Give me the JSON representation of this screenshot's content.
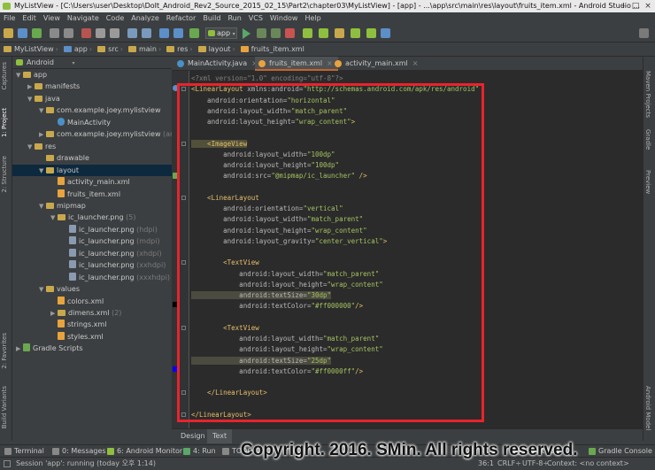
{
  "window": {
    "title": "MyListView - [C:\\Users\\user\\Desktop\\DoIt_Android_Rev2_Source_2015_02_15\\Part2\\chapter03\\MyListView] - [app] - ...\\app\\src\\main\\res\\layout\\fruits_item.xml - Android Studio ..."
  },
  "menu": [
    "File",
    "Edit",
    "View",
    "Navigate",
    "Code",
    "Analyze",
    "Refactor",
    "Build",
    "Run",
    "VCS",
    "Window",
    "Help"
  ],
  "toolbar": {
    "run_config": "app"
  },
  "breadcrumbs": [
    "MyListView",
    "app",
    "src",
    "main",
    "res",
    "layout",
    "fruits_item.xml"
  ],
  "left_strip": {
    "captures": "Captures",
    "project": "1: Project",
    "structure": "2: Structure",
    "favorites": "2: Favorites",
    "build_variants": "Build Variants"
  },
  "right_strip": {
    "maven": "Maven Projects",
    "gradle": "Gradle",
    "preview": "Preview",
    "android_model": "Android Model"
  },
  "project_panel": {
    "view_mode": "Android",
    "tree": [
      {
        "label": "app",
        "depth": 0,
        "arrow": "▼",
        "icon": "folder"
      },
      {
        "label": "manifests",
        "depth": 1,
        "arrow": "▶",
        "icon": "folder"
      },
      {
        "label": "java",
        "depth": 1,
        "arrow": "▼",
        "icon": "folder"
      },
      {
        "label": "com.example.joey.mylistview",
        "depth": 2,
        "arrow": "▼",
        "icon": "folder"
      },
      {
        "label": "MainActivity",
        "depth": 3,
        "arrow": "",
        "icon": "class"
      },
      {
        "label": "com.example.joey.mylistview",
        "suffix": "(andro",
        "depth": 2,
        "arrow": "▶",
        "icon": "folder"
      },
      {
        "label": "res",
        "depth": 1,
        "arrow": "▼",
        "icon": "folder"
      },
      {
        "label": "drawable",
        "depth": 2,
        "arrow": "",
        "icon": "folder"
      },
      {
        "label": "layout",
        "depth": 2,
        "arrow": "▼",
        "icon": "folder",
        "selected": true
      },
      {
        "label": "activity_main.xml",
        "depth": 3,
        "arrow": "",
        "icon": "xml"
      },
      {
        "label": "fruits_item.xml",
        "depth": 3,
        "arrow": "",
        "icon": "xml"
      },
      {
        "label": "mipmap",
        "depth": 2,
        "arrow": "▼",
        "icon": "folder"
      },
      {
        "label": "ic_launcher.png",
        "suffix": "(5)",
        "depth": 3,
        "arrow": "▼",
        "icon": "folder"
      },
      {
        "label": "ic_launcher.png",
        "suffix": "(hdpi)",
        "depth": 4,
        "arrow": "",
        "icon": "png"
      },
      {
        "label": "ic_launcher.png",
        "suffix": "(mdpi)",
        "depth": 4,
        "arrow": "",
        "icon": "png"
      },
      {
        "label": "ic_launcher.png",
        "suffix": "(xhdpi)",
        "depth": 4,
        "arrow": "",
        "icon": "png"
      },
      {
        "label": "ic_launcher.png",
        "suffix": "(xxhdpi)",
        "depth": 4,
        "arrow": "",
        "icon": "png"
      },
      {
        "label": "ic_launcher.png",
        "suffix": "(xxxhdpi)",
        "depth": 4,
        "arrow": "",
        "icon": "png"
      },
      {
        "label": "values",
        "depth": 2,
        "arrow": "▼",
        "icon": "folder"
      },
      {
        "label": "colors.xml",
        "depth": 3,
        "arrow": "",
        "icon": "xml"
      },
      {
        "label": "dimens.xml",
        "suffix": "(2)",
        "depth": 3,
        "arrow": "▶",
        "icon": "folder"
      },
      {
        "label": "strings.xml",
        "depth": 3,
        "arrow": "",
        "icon": "xml"
      },
      {
        "label": "styles.xml",
        "depth": 3,
        "arrow": "",
        "icon": "xml"
      },
      {
        "label": "Gradle Scripts",
        "depth": 0,
        "arrow": "▶",
        "icon": "gradle"
      }
    ]
  },
  "editor_tabs": [
    {
      "label": "MainActivity.java",
      "active": false,
      "icon_color": "#4a90c8"
    },
    {
      "label": "fruits_item.xml",
      "active": true,
      "icon_color": "#e8a33d"
    },
    {
      "label": "activity_main.xml",
      "active": false,
      "icon_color": "#e8a33d"
    }
  ],
  "code_lines": [
    [
      [
        "g",
        "<?xml version=\"1.0\" encoding=\"utf-8\"?>"
      ]
    ],
    [
      [
        "t",
        "<LinearLayout "
      ],
      [
        "a",
        "xmlns:android="
      ],
      [
        "s",
        "\"http://schemas.android.com/apk/res/android\""
      ]
    ],
    [
      [
        "a",
        "    android:orientation="
      ],
      [
        "s",
        "\"horizontal\""
      ]
    ],
    [
      [
        "a",
        "    android:layout_width="
      ],
      [
        "s",
        "\"match_parent\""
      ]
    ],
    [
      [
        "a",
        "    android:layout_height="
      ],
      [
        "s",
        "\"wrap_content\""
      ],
      [
        "t",
        ">"
      ]
    ],
    [],
    [
      [
        "t",
        "    <ImageView",
        "hl"
      ]
    ],
    [
      [
        "a",
        "        android:layout_width="
      ],
      [
        "s",
        "\"100dp\""
      ]
    ],
    [
      [
        "a",
        "        android:layout_height="
      ],
      [
        "s",
        "\"100dp\""
      ]
    ],
    [
      [
        "a",
        "        android:src="
      ],
      [
        "s",
        "\"@mipmap/ic_launcher\""
      ],
      [
        "t",
        " />"
      ]
    ],
    [],
    [
      [
        "t",
        "    <LinearLayout"
      ]
    ],
    [
      [
        "a",
        "        android:orientation="
      ],
      [
        "s",
        "\"vertical\""
      ]
    ],
    [
      [
        "a",
        "        android:layout_width="
      ],
      [
        "s",
        "\"match_parent\""
      ]
    ],
    [
      [
        "a",
        "        android:layout_height="
      ],
      [
        "s",
        "\"wrap_content\""
      ]
    ],
    [
      [
        "a",
        "        android:layout_gravity="
      ],
      [
        "s",
        "\"center_vertical\""
      ],
      [
        "t",
        ">"
      ]
    ],
    [],
    [
      [
        "t",
        "        <TextView"
      ]
    ],
    [
      [
        "a",
        "            android:layout_width="
      ],
      [
        "s",
        "\"match_parent\""
      ]
    ],
    [
      [
        "a",
        "            android:layout_height="
      ],
      [
        "s",
        "\"wrap_content\""
      ]
    ],
    [
      [
        "a",
        "            android:textSize=",
        "attrhl"
      ],
      [
        "s",
        "\"30dp\"",
        "attrhl"
      ]
    ],
    [
      [
        "a",
        "            android:textColor="
      ],
      [
        "s",
        "\"#ff000000\""
      ],
      [
        "t",
        "/>"
      ]
    ],
    [],
    [
      [
        "t",
        "        <TextView"
      ]
    ],
    [
      [
        "a",
        "            android:layout_width="
      ],
      [
        "s",
        "\"match_parent\""
      ]
    ],
    [
      [
        "a",
        "            android:layout_height="
      ],
      [
        "s",
        "\"wrap_content\""
      ]
    ],
    [
      [
        "a",
        "            android:textSize=",
        "attrhl"
      ],
      [
        "s",
        "\"25dp\"",
        "attrhl"
      ]
    ],
    [
      [
        "a",
        "            android:textColor="
      ],
      [
        "s",
        "\"#ff0000ff\""
      ],
      [
        "t",
        "/>"
      ]
    ],
    [],
    [
      [
        "t",
        "    </LinearLayout>"
      ]
    ],
    [],
    [
      [
        "t",
        "</LinearLayout>"
      ]
    ]
  ],
  "bottom_tabs": [
    {
      "label": "Design",
      "active": false
    },
    {
      "label": "Text",
      "active": true
    }
  ],
  "tool_windows": [
    "Terminal",
    "0: Messages",
    "6: Android Monitor",
    "4: Run",
    "TODO",
    "Event Log",
    "Gradle Console"
  ],
  "status": {
    "message": "Session 'app': running (today 오후 1:14)",
    "position": "36:1",
    "line_sep": "CRLF÷",
    "encoding": "UTF-8÷",
    "context": "Context: <no context>"
  },
  "watermark": "Copyright. 2016. SMin. All rights reserved.",
  "colors": {
    "highlight_box": "#e8232c",
    "tag": "#e8bf6a",
    "string": "#a5c261",
    "attr": "#bababa"
  }
}
